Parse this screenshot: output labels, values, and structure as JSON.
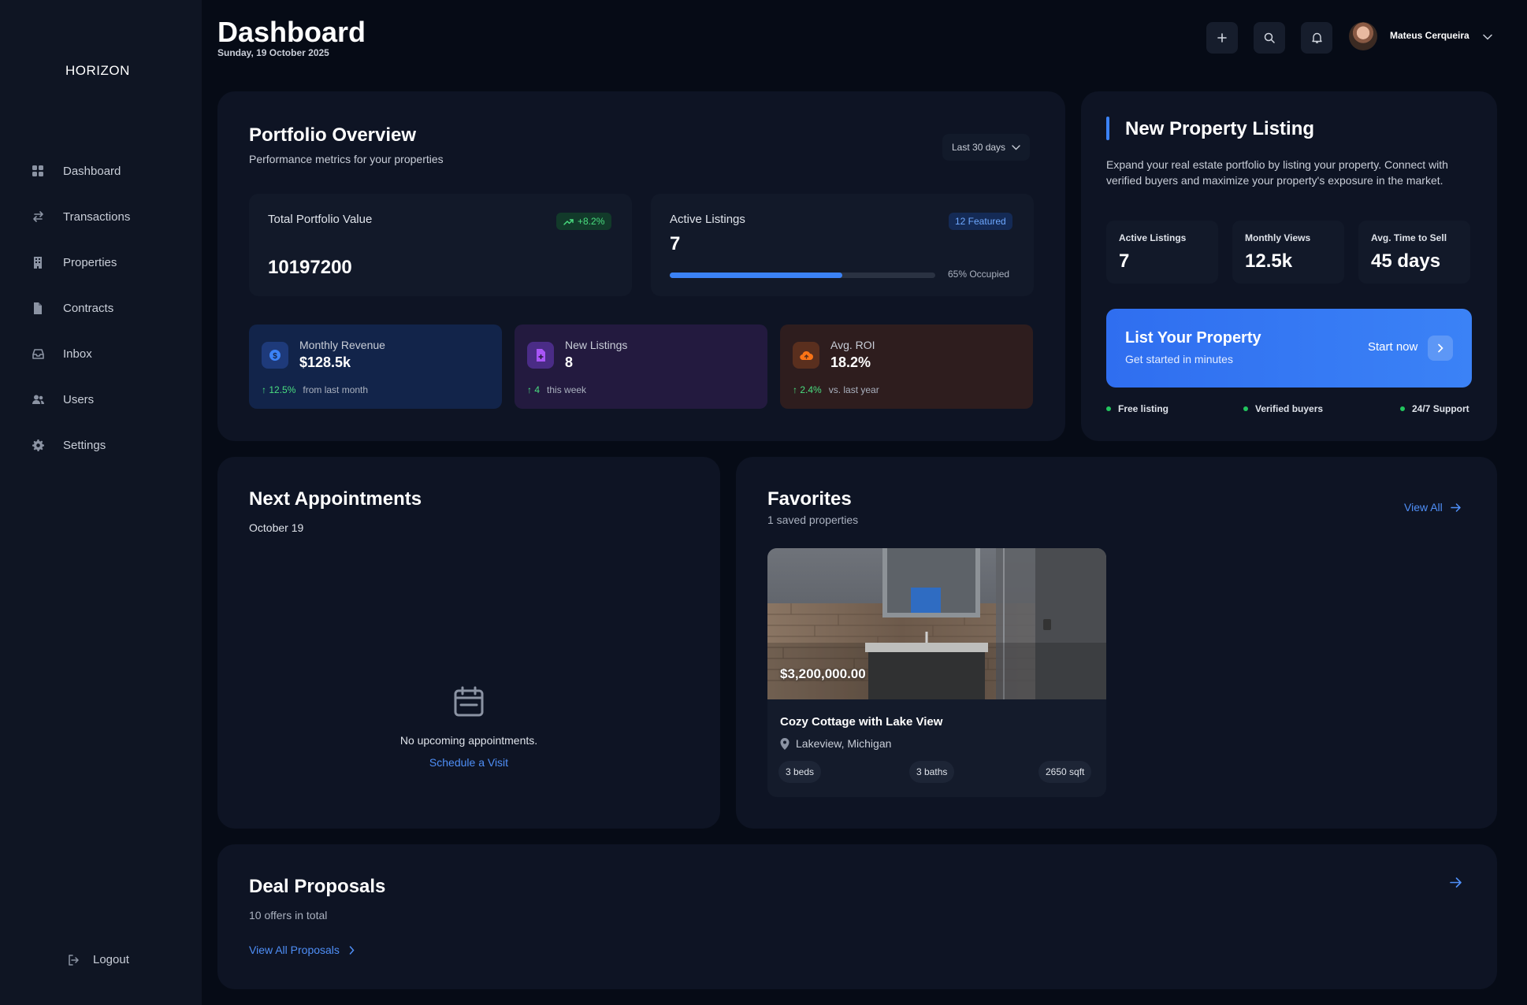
{
  "sidebar": {
    "logo": "HORIZON",
    "items": [
      {
        "label": "Dashboard"
      },
      {
        "label": "Transactions"
      },
      {
        "label": "Properties"
      },
      {
        "label": "Contracts"
      },
      {
        "label": "Inbox"
      },
      {
        "label": "Users"
      },
      {
        "label": "Settings"
      }
    ],
    "logout": "Logout"
  },
  "header": {
    "title": "Dashboard",
    "date": "Sunday, 19 October 2025",
    "user_name": "Mateus Cerqueira"
  },
  "portfolio": {
    "title": "Portfolio Overview",
    "subtitle": "Performance metrics for your properties",
    "range": "Last 30 days",
    "total_value_label": "Total Portfolio Value",
    "total_value_change": "+8.2%",
    "total_value": "10197200",
    "active_listings_label": "Active Listings",
    "active_listings_badge": "12 Featured",
    "active_listings_value": "7",
    "occupied_fraction": 0.65,
    "occupied_text": "65% Occupied",
    "metrics": [
      {
        "label": "Monthly Revenue",
        "value": "$128.5k",
        "change": "12.5%",
        "note": "from last month"
      },
      {
        "label": "New Listings",
        "value": "8",
        "change": "4",
        "note": "this week"
      },
      {
        "label": "Avg. ROI",
        "value": "18.2%",
        "change": "2.4%",
        "note": "vs. last year"
      }
    ]
  },
  "new_listing": {
    "title": "New Property Listing",
    "description": "Expand your real estate portfolio by listing your property. Connect with verified buyers and maximize your property's exposure in the market.",
    "stats": [
      {
        "label": "Active Listings",
        "value": "7"
      },
      {
        "label": "Monthly Views",
        "value": "12.5k"
      },
      {
        "label": "Avg. Time to Sell",
        "value": "45 days"
      }
    ],
    "cta_title": "List Your Property",
    "cta_subtitle": "Get started in minutes",
    "cta_action": "Start now",
    "features": [
      "Free listing",
      "Verified buyers",
      "24/7 Support"
    ]
  },
  "appointments": {
    "title": "Next Appointments",
    "date": "October 19",
    "empty_text": "No upcoming appointments.",
    "empty_link": "Schedule a Visit"
  },
  "favorites": {
    "title": "Favorites",
    "subtitle": "1 saved properties",
    "view_all": "View All",
    "property": {
      "price": "$3,200,000.00",
      "name": "Cozy Cottage with Lake View",
      "location": "Lakeview, Michigan",
      "beds": "3 beds",
      "baths": "3 baths",
      "sqft": "2650 sqft"
    }
  },
  "deals": {
    "title": "Deal Proposals",
    "subtitle": "10 offers in total",
    "link": "View All Proposals"
  },
  "colors": {
    "accent": "#3b82f6",
    "success": "#4ade80",
    "background": "#060b16",
    "card": "#0e1424"
  }
}
